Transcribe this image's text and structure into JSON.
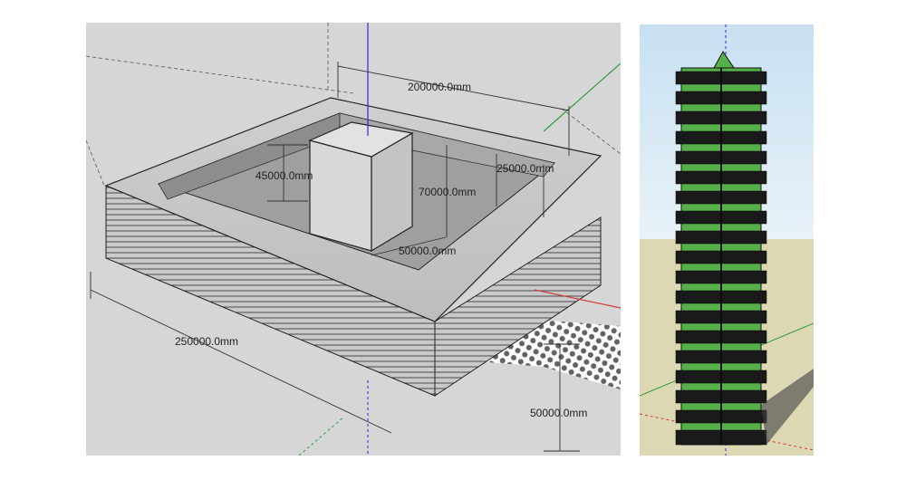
{
  "left_view": {
    "dimensions": {
      "top_width": "200000.0mm",
      "courtyard_offset": "25000.0mm",
      "tower_height": "45000.0mm",
      "inner_depth": "70000.0mm",
      "tower_width": "50000.0mm",
      "base_width": "250000.0mm",
      "base_height": "50000.0mm"
    }
  },
  "right_view": {
    "model": "stacked tower"
  },
  "colors": {
    "viewport_bg": "#d6d6d6",
    "ground": "#ddd8b4",
    "sky": "#bcd9ee",
    "axis_blue": "#2b2bd6",
    "axis_red": "#d23a3a",
    "axis_green": "#2e9b3b",
    "greenery": "#56b04a"
  }
}
